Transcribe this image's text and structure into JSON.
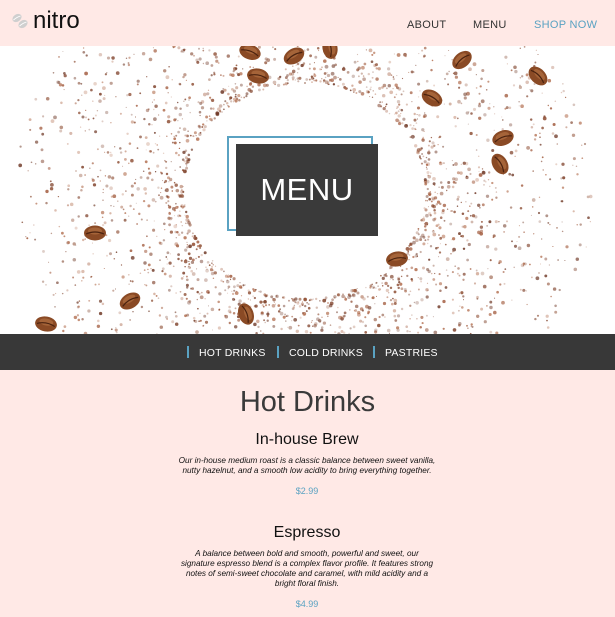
{
  "brand": {
    "name": "nitro",
    "icon": "coffee-bean-logo-icon"
  },
  "nav": {
    "about": "ABOUT",
    "menu": "MENU",
    "shop": "SHOP NOW"
  },
  "hero": {
    "title": "MENU"
  },
  "categories": [
    "HOT DRINKS",
    "COLD DRINKS",
    "PASTRIES"
  ],
  "section": {
    "title": "Hot Drinks",
    "items": [
      {
        "name": "In-house Brew",
        "description": "Our in-house medium roast is a classic balance between sweet vanilla, nutty hazelnut, and a smooth low acidity to bring everything together.",
        "price": "$2.99"
      },
      {
        "name": "Espresso",
        "description": "A balance between bold and smooth, powerful and sweet, our signature espresso blend is a complex flavor profile. It features strong notes of semi-sweet chocolate and caramel, with mild acidity and a bright floral finish.",
        "price": "$4.99"
      }
    ]
  },
  "colors": {
    "background": "#ffe9e6",
    "accent": "#5aa2c2",
    "dark": "#383838"
  }
}
